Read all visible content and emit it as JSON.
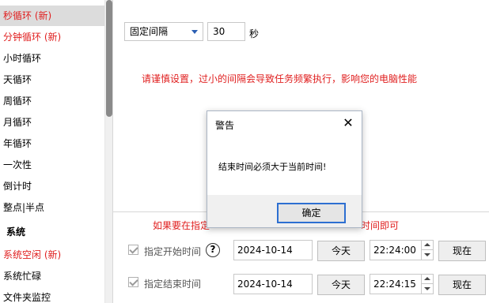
{
  "sidebar": {
    "items": [
      {
        "label": "秒循环 (新)"
      },
      {
        "label": "分钟循环 (新)"
      },
      {
        "label": "小时循环"
      },
      {
        "label": "天循环"
      },
      {
        "label": "周循环"
      },
      {
        "label": "月循环"
      },
      {
        "label": "年循环"
      },
      {
        "label": "一次性"
      },
      {
        "label": "倒计时"
      },
      {
        "label": "整点|半点"
      },
      {
        "label": "系统"
      },
      {
        "label": "系统空闲 (新)"
      },
      {
        "label": "系统忙碌"
      },
      {
        "label": "文件夹监控"
      }
    ]
  },
  "interval": {
    "mode": "固定间隔",
    "value": "30",
    "unit": "秒",
    "warning": "请谨慎设置，过小的间隔会导致任务频繁执行，影响您的电脑性能"
  },
  "hint": {
    "left": "如果要在指定",
    "right": "时间即可"
  },
  "start": {
    "label": "指定开始时间",
    "help": "?",
    "date": "2024-10-14",
    "today": "今天",
    "time": "22:24:00",
    "now": "现在"
  },
  "end": {
    "label": "指定结束时间",
    "date": "2024-10-14",
    "today": "今天",
    "time": "22:24:15",
    "now": "现在"
  },
  "dialog": {
    "title": "警告",
    "close": "✕",
    "message": "结束时间必须大于当前时间!",
    "ok": "确定"
  },
  "colors": {
    "warning_red": "#e02020",
    "ok_border": "#2d6fd1"
  }
}
